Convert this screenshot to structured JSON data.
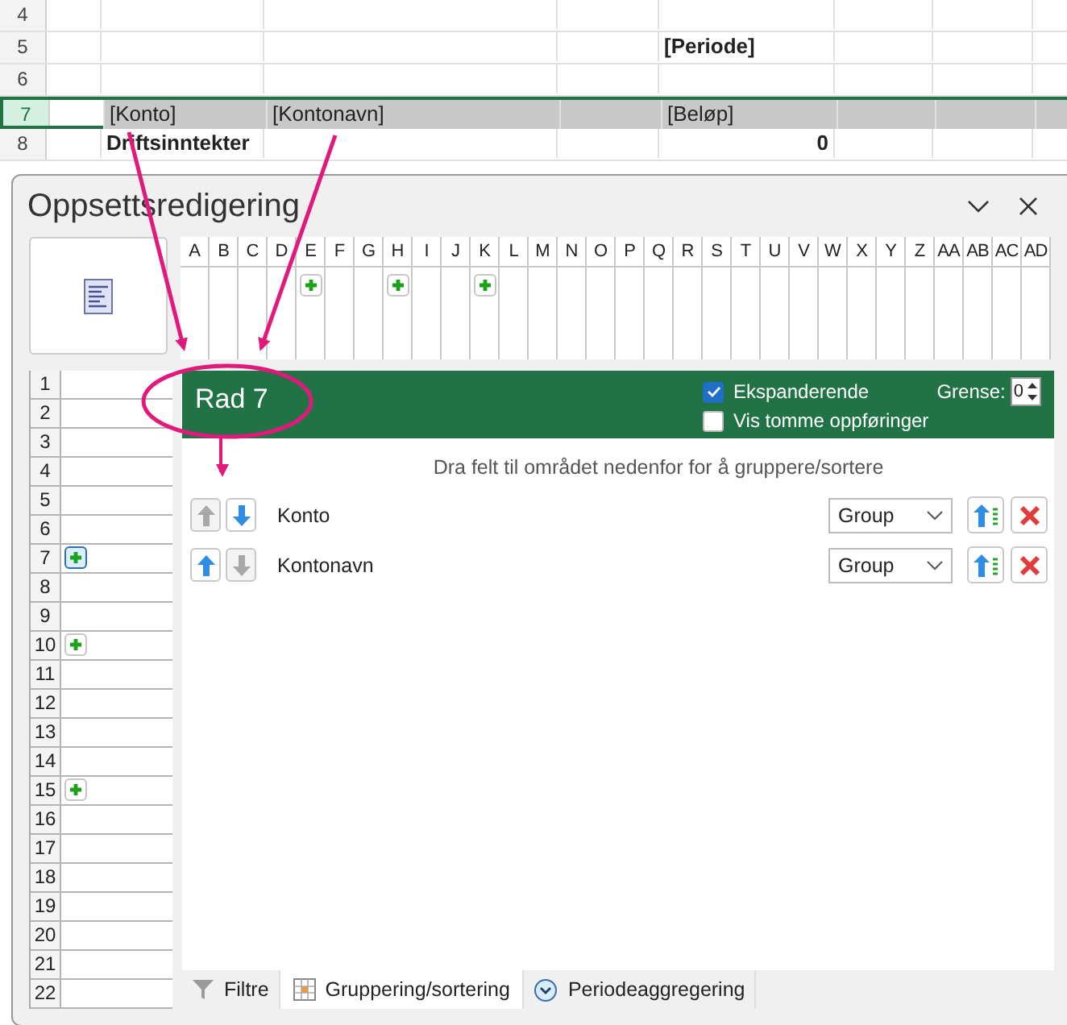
{
  "sheet": {
    "rows": [
      {
        "num": "4",
        "selected": false,
        "cells": []
      },
      {
        "num": "5",
        "selected": false,
        "cells": [
          {},
          {},
          {},
          {},
          {
            "text": "[Periode]",
            "bold": true,
            "kind": "text"
          }
        ]
      },
      {
        "num": "6",
        "selected": false,
        "cells": []
      },
      {
        "num": "7",
        "selected": true,
        "cells": [
          {},
          {
            "text": "[Konto]",
            "bold": false,
            "kind": "text"
          },
          {
            "text": "[Kontonavn]",
            "bold": false,
            "kind": "text"
          },
          {},
          {
            "text": "[Beløp]",
            "bold": false,
            "kind": "text"
          }
        ]
      },
      {
        "num": "8",
        "selected": false,
        "cells": [
          {},
          {
            "text": "Driftsinntekter",
            "bold": true,
            "kind": "text"
          },
          {},
          {},
          {
            "text": "0",
            "bold": true,
            "kind": "number"
          }
        ]
      }
    ]
  },
  "dialog": {
    "title": "Oppsettsredigering",
    "columns": [
      {
        "label": "A",
        "add": false
      },
      {
        "label": "B",
        "add": false
      },
      {
        "label": "C",
        "add": false
      },
      {
        "label": "D",
        "add": false
      },
      {
        "label": "E",
        "add": true
      },
      {
        "label": "F",
        "add": false
      },
      {
        "label": "G",
        "add": false
      },
      {
        "label": "H",
        "add": true
      },
      {
        "label": "I",
        "add": false
      },
      {
        "label": "J",
        "add": false
      },
      {
        "label": "K",
        "add": true
      },
      {
        "label": "L",
        "add": false
      },
      {
        "label": "M",
        "add": false
      },
      {
        "label": "N",
        "add": false
      },
      {
        "label": "O",
        "add": false
      },
      {
        "label": "P",
        "add": false
      },
      {
        "label": "Q",
        "add": false
      },
      {
        "label": "R",
        "add": false
      },
      {
        "label": "S",
        "add": false
      },
      {
        "label": "T",
        "add": false
      },
      {
        "label": "U",
        "add": false
      },
      {
        "label": "V",
        "add": false
      },
      {
        "label": "W",
        "add": false
      },
      {
        "label": "X",
        "add": false
      },
      {
        "label": "Y",
        "add": false
      },
      {
        "label": "Z",
        "add": false
      },
      {
        "label": "AA",
        "add": false
      },
      {
        "label": "AB",
        "add": false
      },
      {
        "label": "AC",
        "add": false
      },
      {
        "label": "AD",
        "add": false
      }
    ],
    "rows": [
      {
        "num": "1",
        "add": false,
        "selected": false
      },
      {
        "num": "2",
        "add": false,
        "selected": false
      },
      {
        "num": "3",
        "add": false,
        "selected": false
      },
      {
        "num": "4",
        "add": false,
        "selected": false
      },
      {
        "num": "5",
        "add": false,
        "selected": false
      },
      {
        "num": "6",
        "add": false,
        "selected": false
      },
      {
        "num": "7",
        "add": true,
        "selected": true
      },
      {
        "num": "8",
        "add": false,
        "selected": false
      },
      {
        "num": "9",
        "add": false,
        "selected": false
      },
      {
        "num": "10",
        "add": true,
        "selected": false
      },
      {
        "num": "11",
        "add": false,
        "selected": false
      },
      {
        "num": "12",
        "add": false,
        "selected": false
      },
      {
        "num": "13",
        "add": false,
        "selected": false
      },
      {
        "num": "14",
        "add": false,
        "selected": false
      },
      {
        "num": "15",
        "add": true,
        "selected": false
      },
      {
        "num": "16",
        "add": false,
        "selected": false
      },
      {
        "num": "17",
        "add": false,
        "selected": false
      },
      {
        "num": "18",
        "add": false,
        "selected": false
      },
      {
        "num": "19",
        "add": false,
        "selected": false
      },
      {
        "num": "20",
        "add": false,
        "selected": false
      },
      {
        "num": "21",
        "add": false,
        "selected": false
      },
      {
        "num": "22",
        "add": false,
        "selected": false
      }
    ],
    "header": {
      "title": "Rad 7",
      "checkboxes": [
        {
          "label": "Ekspanderende",
          "checked": true
        },
        {
          "label": "Vis tomme oppføringer",
          "checked": false
        }
      ],
      "limit_label": "Grense:",
      "limit_value": "0"
    },
    "hint": "Dra felt til området nedenfor for å gruppere/sortere",
    "groupings": [
      {
        "name": "Konto",
        "up_enabled": false,
        "down_enabled": true,
        "mode": "Group"
      },
      {
        "name": "Kontonavn",
        "up_enabled": true,
        "down_enabled": false,
        "mode": "Group"
      }
    ],
    "tabs": [
      {
        "label": "Filtre",
        "kind": "filter",
        "selected": false
      },
      {
        "label": "Gruppering/sortering",
        "kind": "grid",
        "selected": true
      },
      {
        "label": "Periodeaggregering",
        "kind": "clock",
        "selected": false
      }
    ]
  }
}
